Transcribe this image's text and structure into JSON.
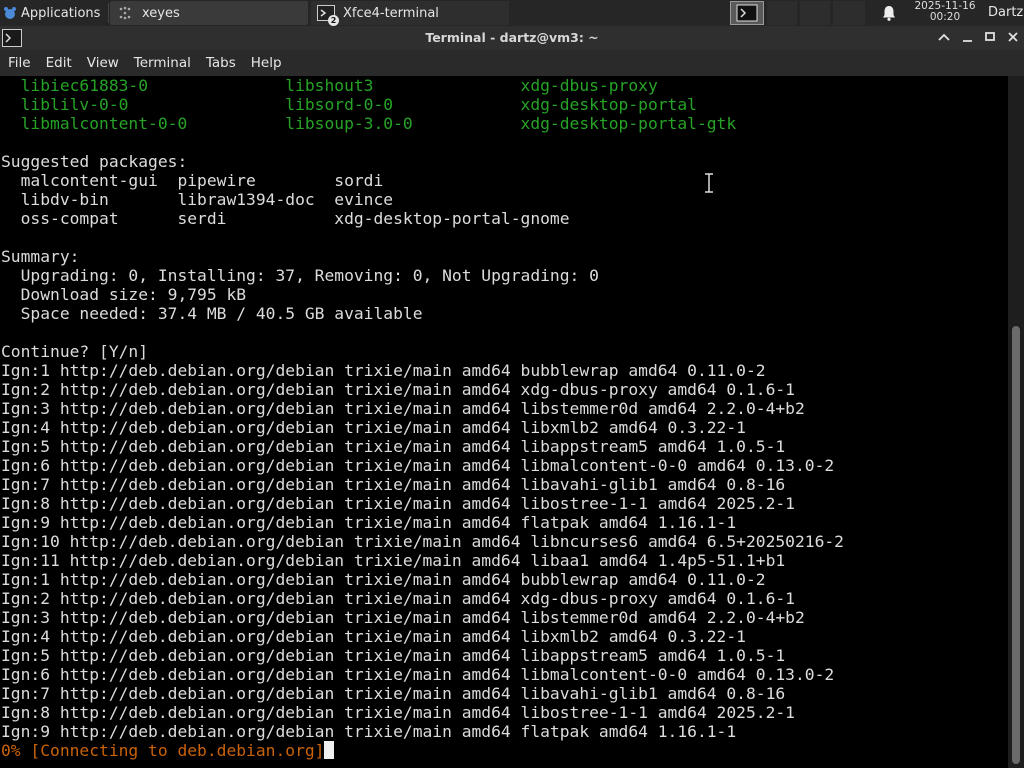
{
  "panel": {
    "apps_label": "Applications",
    "tasks": [
      {
        "label": "xeyes",
        "icon": "eye-icon"
      },
      {
        "label": "Xfce4-terminal",
        "icon": "terminal-icon",
        "badge": "2"
      }
    ],
    "clock_date": "2025-11-16",
    "clock_time": "00:20",
    "user": "Dartz"
  },
  "window": {
    "title": "Terminal - dartz@vm3: ~"
  },
  "menu": [
    "File",
    "Edit",
    "View",
    "Terminal",
    "Tabs",
    "Help"
  ],
  "terminal": {
    "lines": [
      {
        "text": "  libiec61883-0              libshout3               xdg-dbus-proxy",
        "style": "green"
      },
      {
        "text": "  liblilv-0-0                libsord-0-0             xdg-desktop-portal",
        "style": "green"
      },
      {
        "text": "  libmalcontent-0-0          libsoup-3.0-0           xdg-desktop-portal-gtk",
        "style": "green"
      },
      {
        "text": "",
        "style": ""
      },
      {
        "text": "Suggested packages:",
        "style": ""
      },
      {
        "text": "  malcontent-gui  pipewire        sordi",
        "style": ""
      },
      {
        "text": "  libdv-bin       libraw1394-doc  evince",
        "style": ""
      },
      {
        "text": "  oss-compat      serdi           xdg-desktop-portal-gnome",
        "style": ""
      },
      {
        "text": "",
        "style": ""
      },
      {
        "text": "Summary:",
        "style": ""
      },
      {
        "text": "  Upgrading: 0, Installing: 37, Removing: 0, Not Upgrading: 0",
        "style": ""
      },
      {
        "text": "  Download size: 9,795 kB",
        "style": ""
      },
      {
        "text": "  Space needed: 37.4 MB / 40.5 GB available",
        "style": ""
      },
      {
        "text": "",
        "style": ""
      },
      {
        "text": "Continue? [Y/n]",
        "style": ""
      },
      {
        "text": "Ign:1 http://deb.debian.org/debian trixie/main amd64 bubblewrap amd64 0.11.0-2",
        "style": ""
      },
      {
        "text": "Ign:2 http://deb.debian.org/debian trixie/main amd64 xdg-dbus-proxy amd64 0.1.6-1",
        "style": ""
      },
      {
        "text": "Ign:3 http://deb.debian.org/debian trixie/main amd64 libstemmer0d amd64 2.2.0-4+b2",
        "style": ""
      },
      {
        "text": "Ign:4 http://deb.debian.org/debian trixie/main amd64 libxmlb2 amd64 0.3.22-1",
        "style": ""
      },
      {
        "text": "Ign:5 http://deb.debian.org/debian trixie/main amd64 libappstream5 amd64 1.0.5-1",
        "style": ""
      },
      {
        "text": "Ign:6 http://deb.debian.org/debian trixie/main amd64 libmalcontent-0-0 amd64 0.13.0-2",
        "style": ""
      },
      {
        "text": "Ign:7 http://deb.debian.org/debian trixie/main amd64 libavahi-glib1 amd64 0.8-16",
        "style": ""
      },
      {
        "text": "Ign:8 http://deb.debian.org/debian trixie/main amd64 libostree-1-1 amd64 2025.2-1",
        "style": ""
      },
      {
        "text": "Ign:9 http://deb.debian.org/debian trixie/main amd64 flatpak amd64 1.16.1-1",
        "style": ""
      },
      {
        "text": "Ign:10 http://deb.debian.org/debian trixie/main amd64 libncurses6 amd64 6.5+20250216-2",
        "style": ""
      },
      {
        "text": "Ign:11 http://deb.debian.org/debian trixie/main amd64 libaa1 amd64 1.4p5-51.1+b1",
        "style": ""
      },
      {
        "text": "Ign:1 http://deb.debian.org/debian trixie/main amd64 bubblewrap amd64 0.11.0-2",
        "style": ""
      },
      {
        "text": "Ign:2 http://deb.debian.org/debian trixie/main amd64 xdg-dbus-proxy amd64 0.1.6-1",
        "style": ""
      },
      {
        "text": "Ign:3 http://deb.debian.org/debian trixie/main amd64 libstemmer0d amd64 2.2.0-4+b2",
        "style": ""
      },
      {
        "text": "Ign:4 http://deb.debian.org/debian trixie/main amd64 libxmlb2 amd64 0.3.22-1",
        "style": ""
      },
      {
        "text": "Ign:5 http://deb.debian.org/debian trixie/main amd64 libappstream5 amd64 1.0.5-1",
        "style": ""
      },
      {
        "text": "Ign:6 http://deb.debian.org/debian trixie/main amd64 libmalcontent-0-0 amd64 0.13.0-2",
        "style": ""
      },
      {
        "text": "Ign:7 http://deb.debian.org/debian trixie/main amd64 libavahi-glib1 amd64 0.8-16",
        "style": ""
      },
      {
        "text": "Ign:8 http://deb.debian.org/debian trixie/main amd64 libostree-1-1 amd64 2025.2-1",
        "style": ""
      },
      {
        "text": "Ign:9 http://deb.debian.org/debian trixie/main amd64 flatpak amd64 1.16.1-1",
        "style": ""
      }
    ],
    "status_line": "0% [Connecting to deb.debian.org]"
  },
  "colors": {
    "green_text": "#26a326",
    "status_text": "#c8620a",
    "panel_bg": "#262626"
  }
}
